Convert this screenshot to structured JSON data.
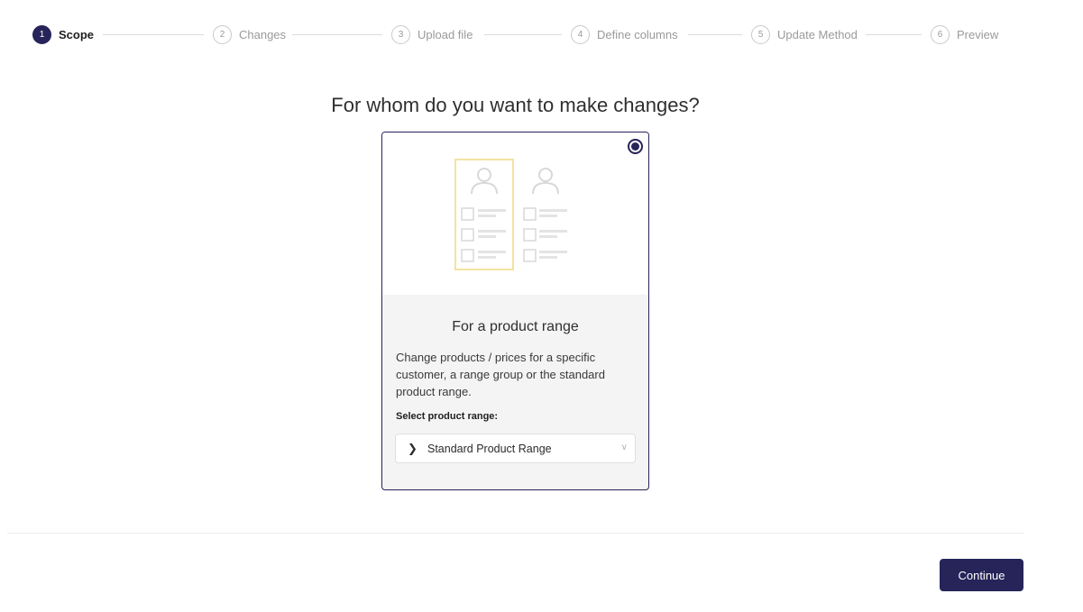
{
  "stepper": {
    "steps": [
      {
        "number": "1",
        "label": "Scope",
        "active": true
      },
      {
        "number": "2",
        "label": "Changes",
        "active": false
      },
      {
        "number": "3",
        "label": "Upload file",
        "active": false
      },
      {
        "number": "4",
        "label": "Define columns",
        "active": false
      },
      {
        "number": "5",
        "label": "Update Method",
        "active": false
      },
      {
        "number": "6",
        "label": "Preview",
        "active": false
      }
    ]
  },
  "main": {
    "question": "For whom do you want to make changes?",
    "card": {
      "selected": true,
      "illustration": "customer-product-lists-illustration",
      "title": "For a product range",
      "description": "Change products / prices for a specific customer, a range group or the standard product range.",
      "select_label": "Select product range:",
      "select_value": "Standard Product Range"
    }
  },
  "footer": {
    "continue_label": "Continue"
  },
  "colors": {
    "accent": "#262459",
    "highlight": "#f3e3a0"
  }
}
